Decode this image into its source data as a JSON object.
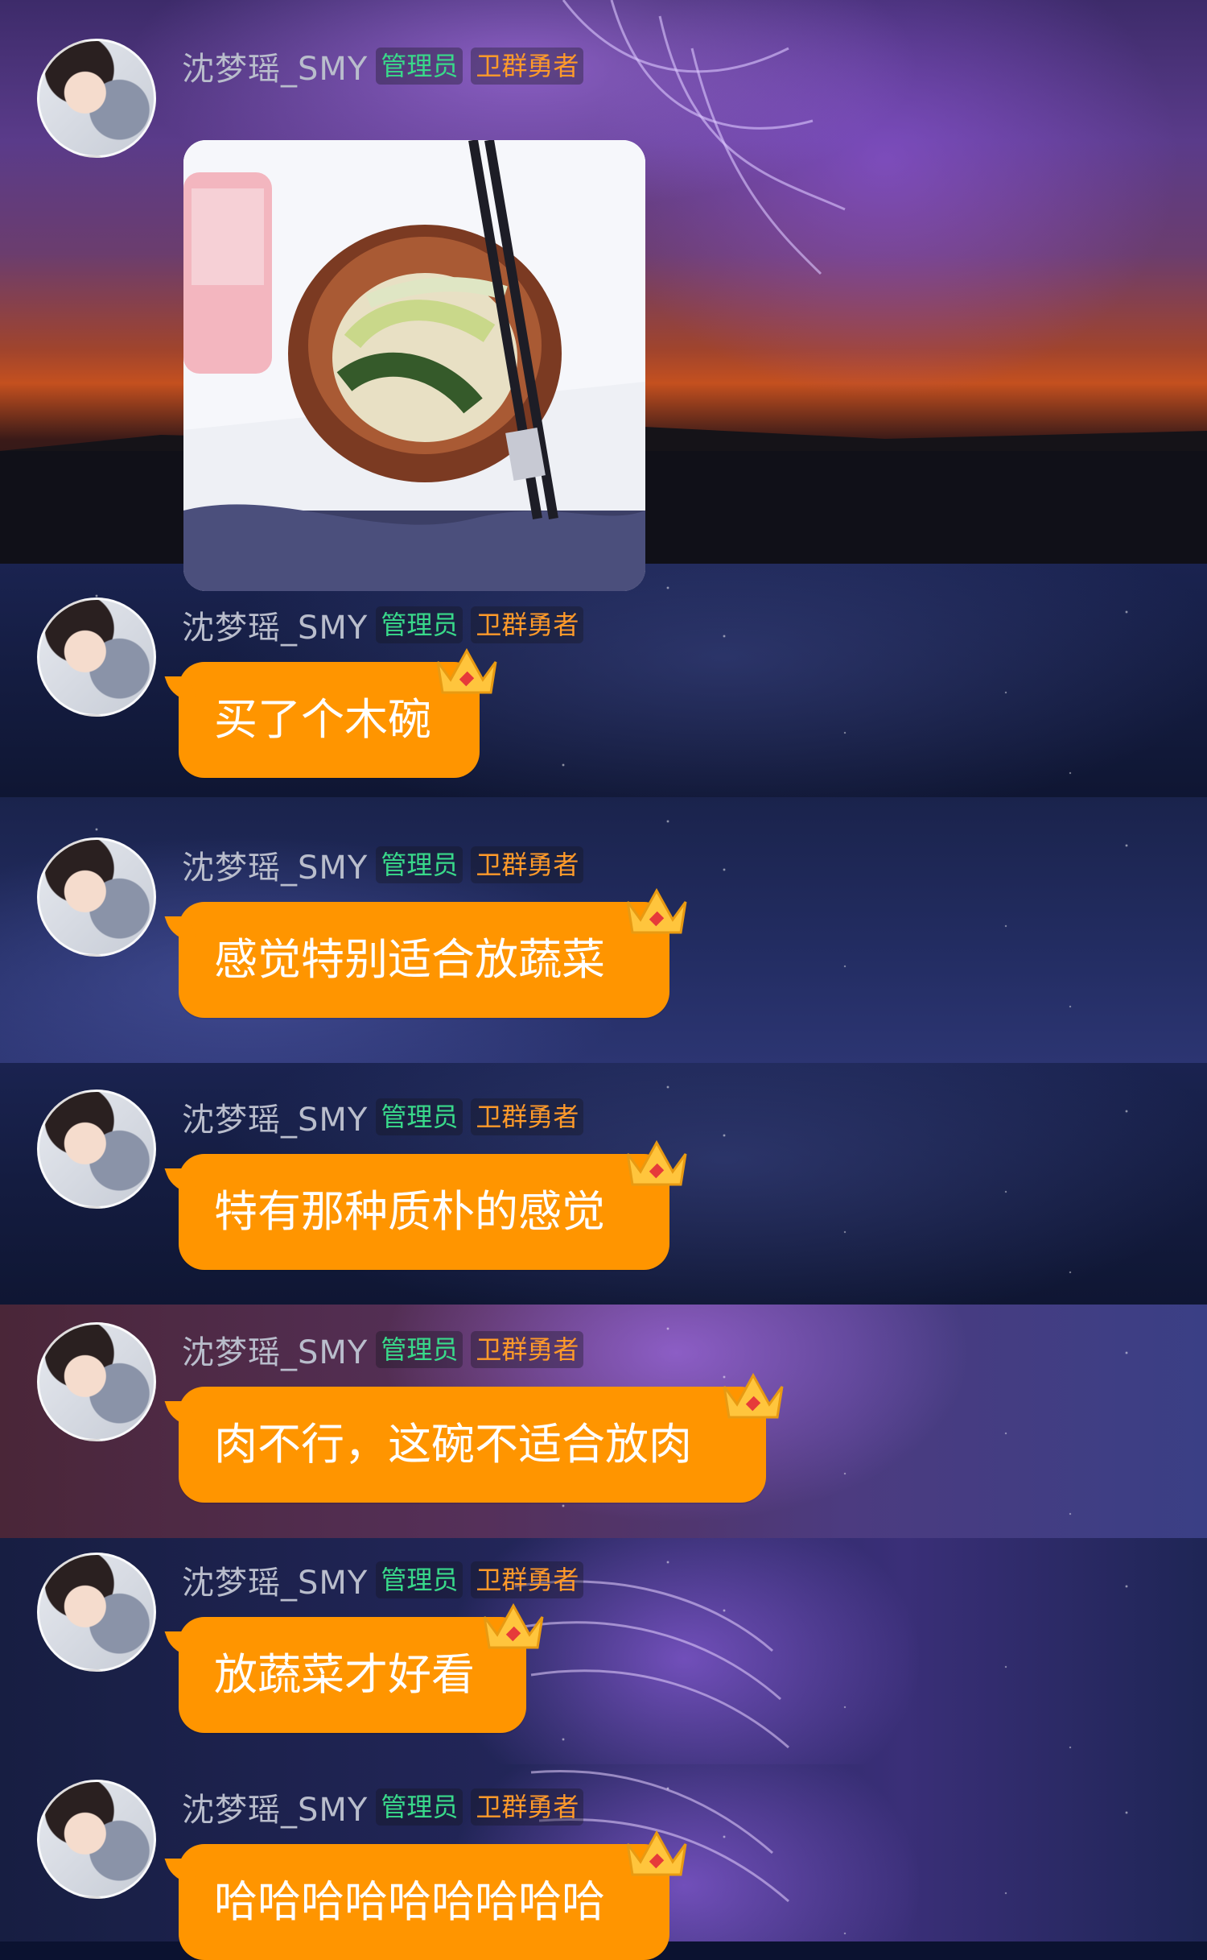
{
  "user": {
    "name": "沈梦瑶_SMY",
    "tags": [
      "管理员",
      "卫群勇者"
    ]
  },
  "messages": [
    {
      "type": "image",
      "alt_icon": "food-photo"
    },
    {
      "type": "text",
      "text": "买了个木碗"
    },
    {
      "type": "text",
      "text": "感觉特别适合放蔬菜"
    },
    {
      "type": "text",
      "text": "特有那种质朴的感觉"
    },
    {
      "type": "text",
      "text": "肉不行，这碗不适合放肉"
    },
    {
      "type": "text",
      "text": "放蔬菜才好看"
    },
    {
      "type": "text",
      "text": "哈哈哈哈哈哈哈哈哈"
    }
  ],
  "colors": {
    "bubble": "#ff9500",
    "tag_admin": "#39d98a",
    "tag_guard": "#ff9a2a",
    "username": "#b9bdcc"
  }
}
